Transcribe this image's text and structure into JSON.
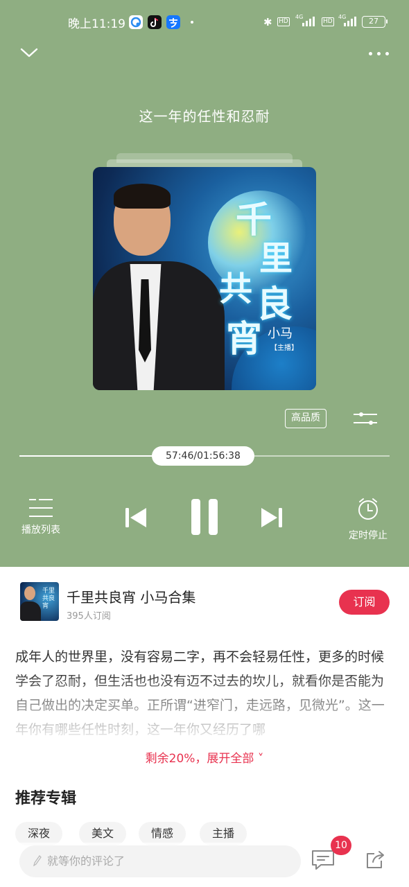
{
  "status_bar": {
    "time": "晚上11:19",
    "bluetooth": "✱",
    "hd_1": "HD",
    "net_1": "4G",
    "hd_2": "HD",
    "net_2": "4G",
    "battery": "27"
  },
  "player": {
    "background_color": "#8fae82",
    "track_title": "这一年的任性和忍耐",
    "cover": {
      "title_chars": [
        "千",
        "里",
        "共",
        "良",
        "宵"
      ],
      "host": "小马",
      "host_tag": "【主播】"
    },
    "quality_label": "高品质",
    "progress_time": "57:46/01:56:38",
    "progress_fraction": 0.495,
    "playlist_label": "播放列表",
    "timer_label": "定时停止"
  },
  "album": {
    "name": "千里共良宵 小马合集",
    "subscribers": "395人订阅",
    "subscribe_label": "订阅",
    "accent_color": "#e8324f"
  },
  "description": {
    "text": "成年人的世界里，没有容易二字，再不会轻易任性，更多的时候学会了忍耐，但生活也也没有迈不过去的坎儿，就看你是否能为自己做出的决定买单。正所谓“进窄门，走远路，见微光”。这一年你有哪些任性时刻，这一年你又经历了哪",
    "expand_label": "剩余20%，展开全部 ˅"
  },
  "recommend": {
    "title": "推荐专辑",
    "tags": [
      "深夜",
      "美文",
      "情感",
      "主播"
    ]
  },
  "comment_bar": {
    "placeholder": "就等你的评论了",
    "comment_count": "10"
  }
}
